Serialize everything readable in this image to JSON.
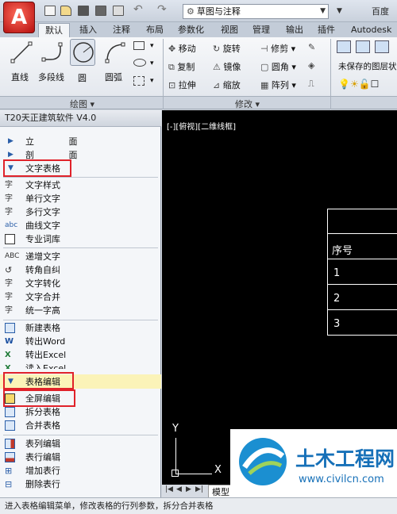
{
  "app": {
    "app_button_glyph": "A",
    "workspace": "草图与注释",
    "title": "百度"
  },
  "quick_access": [
    "new-icon",
    "open-icon",
    "save-icon",
    "saveas-icon",
    "print-icon",
    "undo-icon",
    "redo-icon"
  ],
  "tabs": [
    "默认",
    "插入",
    "注释",
    "布局",
    "参数化",
    "视图",
    "管理",
    "输出",
    "插件",
    "Autodesk"
  ],
  "ribbon": {
    "draw": {
      "items": [
        "直线",
        "多段线",
        "圆",
        "圆弧"
      ],
      "title": "绘图 ▾"
    },
    "modify": {
      "rows": [
        [
          "移动",
          "旋转",
          "修剪 ▾"
        ],
        [
          "复制",
          "镜像",
          "圆角 ▾"
        ],
        [
          "拉伸",
          "缩放",
          "阵列 ▾"
        ]
      ],
      "title": "修改 ▾"
    },
    "layers": {
      "unsaved_state": "未保存的图层状"
    }
  },
  "palette": {
    "title": "T20天正建筑软件 V4.0",
    "categories_top": [
      {
        "label": "立  面",
        "collapsed": true
      },
      {
        "label": "剖  面",
        "collapsed": true
      },
      {
        "label": "文字表格",
        "collapsed": false
      }
    ],
    "text_group_1": [
      "文字样式",
      "单行文字",
      "多行文字",
      "曲线文字",
      "专业词库"
    ],
    "text_group_2": [
      "递增文字",
      "转角自纠",
      "文字转化",
      "文字合并",
      "统一字高"
    ],
    "table_group": [
      "新建表格",
      "转出Word",
      "转出Excel",
      "读入Excel"
    ],
    "sub_category": "表格编辑",
    "edit_group_1": [
      "全屏编辑",
      "拆分表格",
      "合并表格"
    ],
    "edit_group_2": [
      "表列编辑",
      "表行编辑",
      "增加表行",
      "删除表行"
    ]
  },
  "canvas": {
    "viewport_label": "[-][俯视][二维线框]",
    "table_rows": [
      "序号",
      "1",
      "2",
      "3"
    ],
    "axis_y": "Y",
    "axis_x": "X",
    "model_tab": "模型"
  },
  "status": "进入表格编辑菜单，修改表格的行列参数，拆分合并表格",
  "watermark": {
    "brand": "土木工程网",
    "url": "www.civilcn.com"
  },
  "colors": {
    "highlight_box": "#e0222a",
    "accent_blue": "#2a5ea8",
    "canvas_bg": "#000000"
  }
}
